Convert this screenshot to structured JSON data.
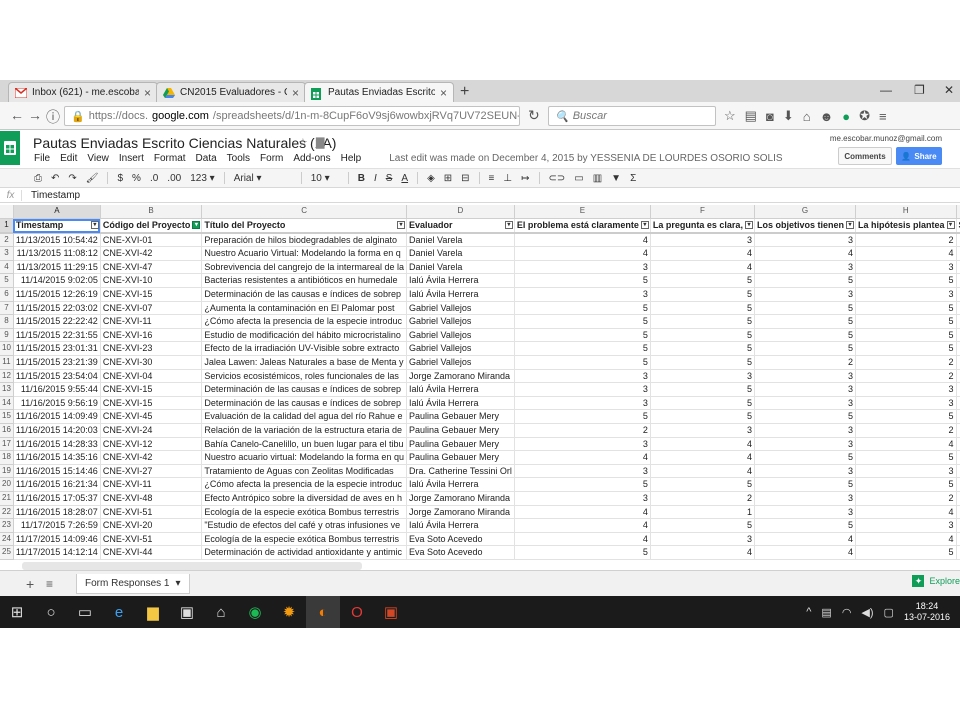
{
  "browser": {
    "tabs": [
      {
        "label": "Inbox (621) - me.escobar....",
        "icon": "gmail-icon",
        "color": "#d93025"
      },
      {
        "label": "CN2015 Evaluadores - Go...",
        "icon": "drive-icon",
        "color": "#f4b400"
      },
      {
        "label": "Pautas Enviadas Escrito Ci...",
        "icon": "sheets-icon",
        "color": "#0f9d58"
      }
    ],
    "url_proto": "https://docs.",
    "url_domain": "google.com",
    "url_path": "/spreadsheets/d/1n-m-8CupF6oV9sj6wowbxjRVq7UV72SEUN-bV8CDGX4/edit#g",
    "search_placeholder": "Buscar"
  },
  "doc": {
    "title": "Pautas Enviadas Escrito Ciencias Naturales (1A)",
    "menus": [
      "File",
      "Edit",
      "View",
      "Insert",
      "Format",
      "Data",
      "Tools",
      "Form",
      "Add-ons",
      "Help"
    ],
    "last_edit": "Last edit was made on December 4, 2015 by YESSENIA DE LOURDES OSORIO SOLIS",
    "user_email": "me.escobar.munoz@gmail.com",
    "comments_label": "Comments",
    "share_label": "Share",
    "font": "Arial",
    "font_size": "10",
    "number_format": "123",
    "formula_value": "Timestamp"
  },
  "grid": {
    "columns": [
      "A",
      "B",
      "C",
      "D",
      "E",
      "F",
      "G",
      "H",
      "I"
    ],
    "headers": [
      "Timestamp",
      "Código del Proyecto",
      "Título del Proyecto",
      "Evaluador",
      "El problema está claramente",
      "La pregunta es clara,",
      "Los objetivos tienen",
      "La hipótesis plantea",
      "Se presenta una a"
    ],
    "rows": [
      [
        "11/13/2015 10:54:42",
        "CNE-XVI-01",
        "Preparación de hilos biodegradables de alginato",
        "Daniel Varela",
        "4",
        "3",
        "3",
        "2"
      ],
      [
        "11/13/2015 11:08:12",
        "CNE-XVI-42",
        "Nuestro Acuario Virtual: Modelando la forma en q",
        "Daniel Varela",
        "4",
        "4",
        "4",
        "4"
      ],
      [
        "11/13/2015 11:29:15",
        "CNE-XVI-47",
        "Sobrevivencia del cangrejo de la intermareal de la",
        "Daniel Varela",
        "3",
        "4",
        "3",
        "3"
      ],
      [
        "11/14/2015 9:02:05",
        "CNE-XVI-10",
        "Bacterias resistentes a antibióticos en humedale",
        "Ialú Ávila Herrera",
        "5",
        "5",
        "5",
        "5"
      ],
      [
        "11/15/2015 12:26:19",
        "CNE-XVI-15",
        "Determinación de las causas e índices de sobrep",
        "Ialú Ávila Herrera",
        "3",
        "5",
        "3",
        "3"
      ],
      [
        "11/15/2015 22:03:02",
        "CNE-XVI-07",
        "¿Aumenta la contaminación en El Palomar post",
        "Gabriel Vallejos",
        "5",
        "5",
        "5",
        "5"
      ],
      [
        "11/15/2015 22:22:42",
        "CNE-XVI-11",
        "¿Cómo afecta la presencia de la especie introduc",
        "Gabriel Vallejos",
        "5",
        "5",
        "5",
        "5"
      ],
      [
        "11/15/2015 22:31:55",
        "CNE-XVI-16",
        "Estudio de modificación del hábito microcristalino",
        "Gabriel Vallejos",
        "5",
        "5",
        "5",
        "5"
      ],
      [
        "11/15/2015 23:01:31",
        "CNE-XVI-23",
        "Efecto de la irradiación UV-Visible sobre extracto",
        "Gabriel Vallejos",
        "5",
        "5",
        "5",
        "5"
      ],
      [
        "11/15/2015 23:21:39",
        "CNE-XVI-30",
        "Jalea Lawen: Jaleas Naturales a base de Menta y",
        "Gabriel Vallejos",
        "5",
        "5",
        "2",
        "2"
      ],
      [
        "11/15/2015 23:54:04",
        "CNE-XVI-04",
        "Servicios ecosistémicos, roles funcionales de las",
        "Jorge Zamorano Miranda",
        "3",
        "3",
        "3",
        "2"
      ],
      [
        "11/16/2015 9:55:44",
        "CNE-XVI-15",
        "Determinación de las causas e índices de sobrep",
        "Ialú Ávila Herrera",
        "3",
        "5",
        "3",
        "3"
      ],
      [
        "11/16/2015 9:56:19",
        "CNE-XVI-15",
        "Determinación de las causas e índices de sobrep",
        "Ialú Ávila Herrera",
        "3",
        "5",
        "3",
        "3"
      ],
      [
        "11/16/2015 14:09:49",
        "CNE-XVI-45",
        "Evaluación de la calidad del agua del río Rahue e",
        "Paulina Gebauer Mery",
        "5",
        "5",
        "5",
        "5"
      ],
      [
        "11/16/2015 14:20:03",
        "CNE-XVI-24",
        "Relación de la variación de la estructura etaria de",
        "Paulina Gebauer Mery",
        "2",
        "3",
        "3",
        "2"
      ],
      [
        "11/16/2015 14:28:33",
        "CNE-XVI-12",
        "Bahía Canelo-Canelillo, un buen lugar para el tibu",
        "Paulina Gebauer Mery",
        "3",
        "4",
        "3",
        "4"
      ],
      [
        "11/16/2015 14:35:16",
        "CNE-XVI-42",
        "Nuestro acuario virtual: Modelando la forma en qu",
        "Paulina Gebauer Mery",
        "4",
        "4",
        "5",
        "5"
      ],
      [
        "11/16/2015 15:14:46",
        "CNE-XVI-27",
        "Tratamiento de Aguas con Zeolitas Modificadas",
        "Dra. Catherine Tessini Orl",
        "3",
        "4",
        "3",
        "3"
      ],
      [
        "11/16/2015 16:21:34",
        "CNE-XVI-11",
        "¿Cómo afecta la presencia de la especie introduc",
        "Ialú Ávila Herrera",
        "5",
        "5",
        "5",
        "5"
      ],
      [
        "11/16/2015 17:05:37",
        "CNE-XVI-48",
        "Efecto Antrópico sobre la diversidad de aves en h",
        "Jorge Zamorano Miranda",
        "3",
        "2",
        "3",
        "2"
      ],
      [
        "11/16/2015 18:28:07",
        "CNE-XVI-51",
        "Ecología de la especie exótica Bombus terrestris",
        "Jorge Zamorano Miranda",
        "4",
        "1",
        "3",
        "4"
      ],
      [
        "11/17/2015 7:26:59",
        "CNE-XVI-20",
        "\"Estudio de efectos del café y otras infusiones ve",
        "Ialú Ávila Herrera",
        "4",
        "5",
        "5",
        "3"
      ],
      [
        "11/17/2015 14:09:46",
        "CNE-XVI-51",
        "Ecología de la especie exótica Bombus terrestris",
        "Eva Soto Acevedo",
        "4",
        "3",
        "4",
        "4"
      ],
      [
        "11/17/2015 14:12:14",
        "CNE-XVI-44",
        "Determinación de actividad antioxidante y antimic",
        "Eva Soto Acevedo",
        "5",
        "4",
        "4",
        "5"
      ]
    ]
  },
  "sheet_tab": "Form Responses 1",
  "explore_label": "Explore",
  "clock": {
    "time": "18:24",
    "date": "13-07-2016"
  }
}
